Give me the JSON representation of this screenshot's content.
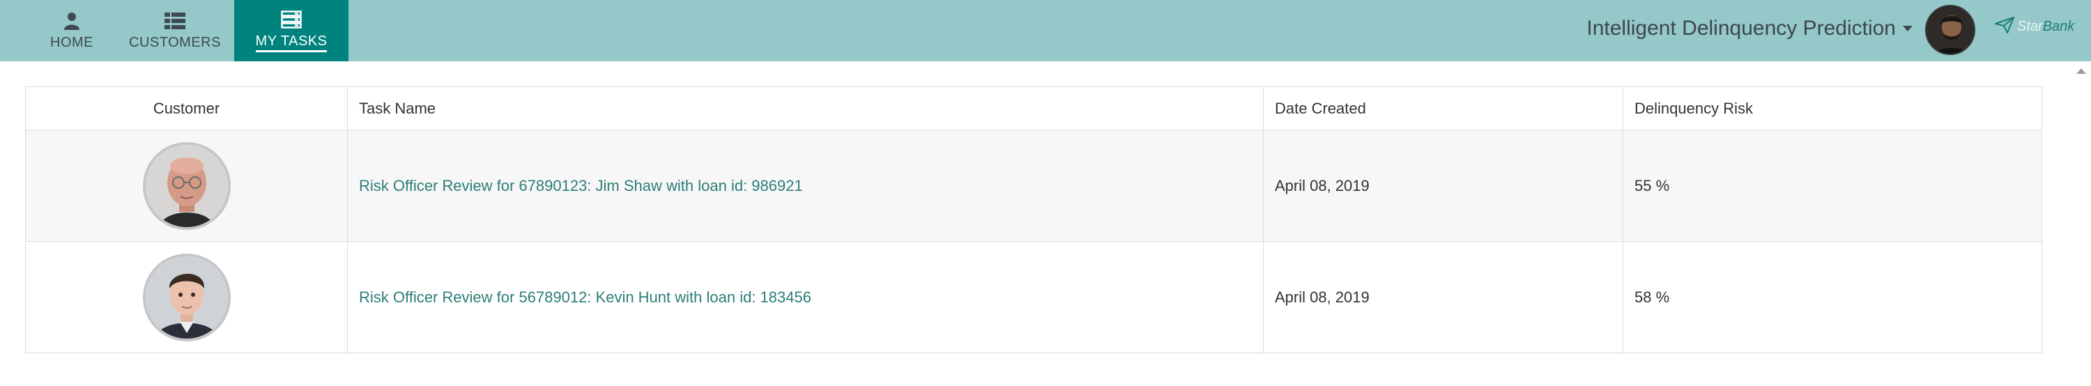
{
  "nav": {
    "items": [
      {
        "label": "HOME",
        "icon": "user-icon"
      },
      {
        "label": "CUSTOMERS",
        "icon": "list-icon"
      },
      {
        "label": "MY TASKS",
        "icon": "tasks-icon",
        "active": true
      }
    ]
  },
  "header": {
    "app_title": "Intelligent Delinquency Prediction",
    "brand": {
      "star": "Star",
      "bank": "Bank"
    }
  },
  "table": {
    "columns": [
      "Customer",
      "Task Name",
      "Date Created",
      "Delinquency Risk"
    ],
    "rows": [
      {
        "task": "Risk Officer Review for 67890123: Jim Shaw with loan id: 986921",
        "date": "April 08, 2019",
        "risk": "55 %"
      },
      {
        "task": "Risk Officer Review for 56789012: Kevin Hunt with loan id: 183456",
        "date": "April 08, 2019",
        "risk": "58 %"
      }
    ]
  },
  "colors": {
    "topbar": "#95c8c8",
    "active_tab": "#00837f",
    "link": "#2d7d78"
  }
}
